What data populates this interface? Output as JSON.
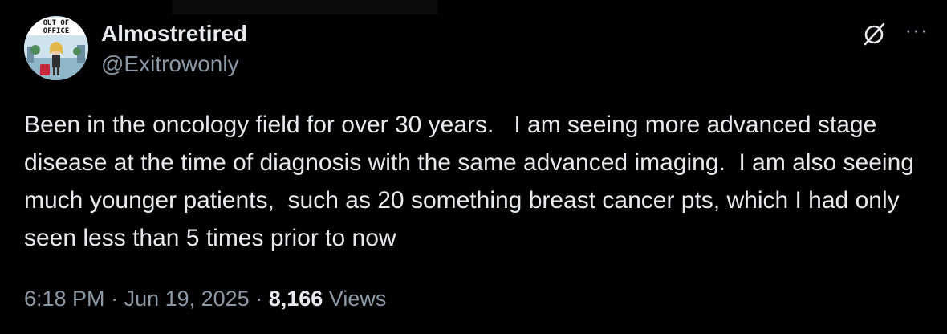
{
  "author": {
    "display_name": "Almostretired",
    "handle": "@Exitrowonly",
    "avatar_text": "OUT OF OFFICE"
  },
  "actions": {
    "grok_icon": "slashed-circle-icon",
    "more_icon": "more-dots-icon",
    "more_label": "···"
  },
  "tweet": {
    "text": "Been in the oncology field for over 30 years.   I am seeing more advanced stage disease at the time of diagnosis with the same advanced imaging.  I am also seeing much younger patients,  such as 20 something breast cancer pts, which I had only seen less than 5 times prior to now"
  },
  "meta": {
    "time": "6:18 PM",
    "date": "Jun 19, 2025",
    "separator": " · ",
    "views_count": "8,166",
    "views_label": "Views"
  },
  "colors": {
    "background": "#000000",
    "text_primary": "#e7e9ea",
    "text_secondary": "#8b98a5"
  }
}
